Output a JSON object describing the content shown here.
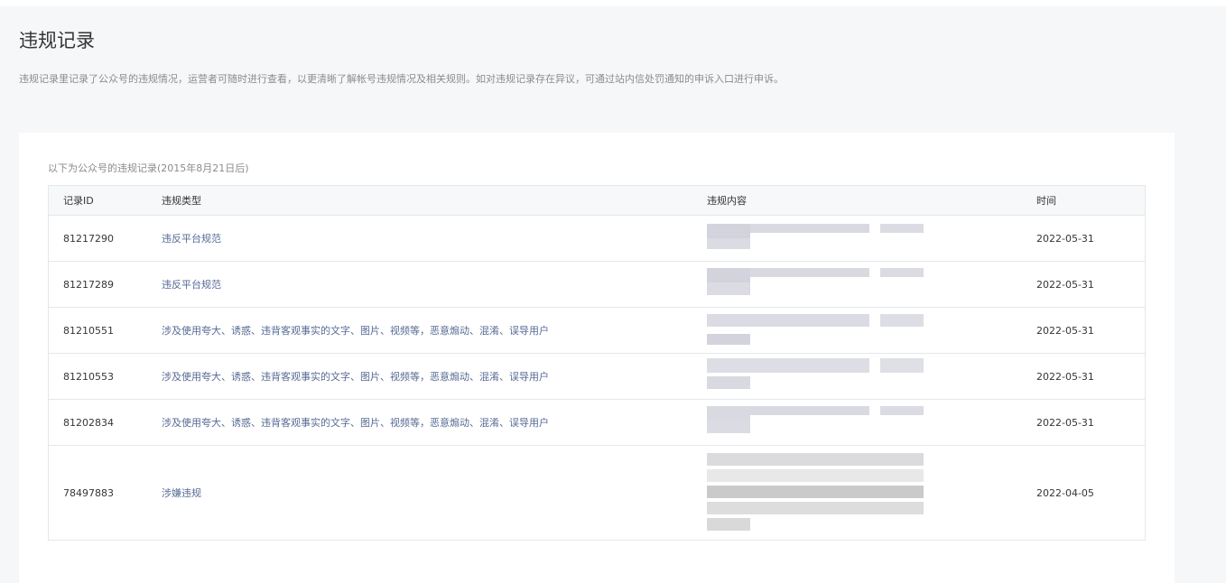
{
  "page": {
    "title": "违规记录",
    "description": "违规记录里记录了公众号的违规情况，运营者可随时进行查看，以更清晰了解帐号违规情况及相关规则。如对违规记录存在异议，可通过站内信处罚通知的申诉入口进行申诉。"
  },
  "records": {
    "note": "以下为公众号的违规记录(2015年8月21日后)",
    "columns": {
      "id": "记录ID",
      "type": "违规类型",
      "content": "违规内容",
      "time": "时间"
    },
    "rows": [
      {
        "id": "81217290",
        "type": "违反平台规范",
        "time": "2022-05-31"
      },
      {
        "id": "81217289",
        "type": "违反平台规范",
        "time": "2022-05-31"
      },
      {
        "id": "81210551",
        "type": "涉及使用夸大、诱惑、违背客观事实的文字、图片、视频等，恶意煽动、混淆、误导用户",
        "time": "2022-05-31"
      },
      {
        "id": "81210553",
        "type": "涉及使用夸大、诱惑、违背客观事实的文字、图片、视频等，恶意煽动、混淆、误导用户",
        "time": "2022-05-31"
      },
      {
        "id": "81202834",
        "type": "涉及使用夸大、诱惑、违背客观事实的文字、图片、视频等，恶意煽动、混淆、误导用户",
        "time": "2022-05-31"
      },
      {
        "id": "78497883",
        "type": "涉嫌违规",
        "time": "2022-04-05"
      }
    ]
  }
}
